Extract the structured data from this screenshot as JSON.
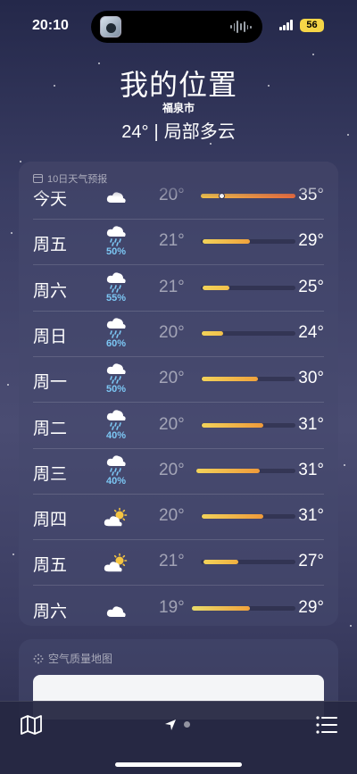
{
  "status_bar": {
    "time": "20:10",
    "battery": "56"
  },
  "header": {
    "title": "我的位置",
    "subtitle": "福泉市",
    "temperature": "24°",
    "separator": "|",
    "condition": "局部多云"
  },
  "forecast": {
    "header_label": "10日天气预报",
    "header_icon": "calendar-icon",
    "rows": [
      {
        "day": "今天",
        "icon": "partly-cloudy-night-icon",
        "pop": "",
        "low": "20°",
        "high": "35°",
        "bar_start": 0.0,
        "bar_end": 1.0,
        "current": 0.22,
        "colors": [
          "#f0c14a",
          "#e8693c"
        ]
      },
      {
        "day": "周五",
        "icon": "rain-icon",
        "pop": "50%",
        "low": "21°",
        "high": "29°",
        "bar_start": 0.02,
        "bar_end": 0.52,
        "colors": [
          "#f2d35a",
          "#f0a23c"
        ]
      },
      {
        "day": "周六",
        "icon": "rain-icon",
        "pop": "55%",
        "low": "21°",
        "high": "25°",
        "bar_start": 0.02,
        "bar_end": 0.3,
        "colors": [
          "#f2d35a",
          "#f2c04a"
        ]
      },
      {
        "day": "周日",
        "icon": "rain-icon",
        "pop": "60%",
        "low": "20°",
        "high": "24°",
        "bar_start": 0.01,
        "bar_end": 0.24,
        "colors": [
          "#f2d35a",
          "#f2c04a"
        ]
      },
      {
        "day": "周一",
        "icon": "rain-icon",
        "pop": "50%",
        "low": "20°",
        "high": "30°",
        "bar_start": 0.01,
        "bar_end": 0.6,
        "colors": [
          "#f2d35a",
          "#f0a23c"
        ]
      },
      {
        "day": "周二",
        "icon": "rain-icon",
        "pop": "40%",
        "low": "20°",
        "high": "31°",
        "bar_start": 0.01,
        "bar_end": 0.66,
        "colors": [
          "#f2d35a",
          "#ef9a3a"
        ]
      },
      {
        "day": "周三",
        "icon": "rain-icon",
        "pop": "40%",
        "low": "20°",
        "high": "31°",
        "bar_start": -0.05,
        "bar_end": 0.62,
        "colors": [
          "#f2d35a",
          "#ef9a3a"
        ]
      },
      {
        "day": "周四",
        "icon": "partly-cloudy-day-icon",
        "pop": "",
        "low": "20°",
        "high": "31°",
        "bar_start": 0.01,
        "bar_end": 0.66,
        "colors": [
          "#f2d35a",
          "#ef9a3a"
        ]
      },
      {
        "day": "周五",
        "icon": "partly-cloudy-day-icon",
        "pop": "",
        "low": "21°",
        "high": "27°",
        "bar_start": 0.03,
        "bar_end": 0.4,
        "colors": [
          "#f2d35a",
          "#f0b040"
        ]
      },
      {
        "day": "周六",
        "icon": "cloudy-icon",
        "pop": "",
        "low": "19°",
        "high": "29°",
        "bar_start": -0.09,
        "bar_end": 0.52,
        "colors": [
          "#e9dc6a",
          "#f0a23c"
        ]
      }
    ]
  },
  "air_quality": {
    "header_label": "空气质量地图",
    "header_icon": "air-quality-icon"
  },
  "bottom_bar": {
    "map_icon": "map-icon",
    "location_icon": "location-arrow-icon",
    "list_icon": "list-icon"
  }
}
